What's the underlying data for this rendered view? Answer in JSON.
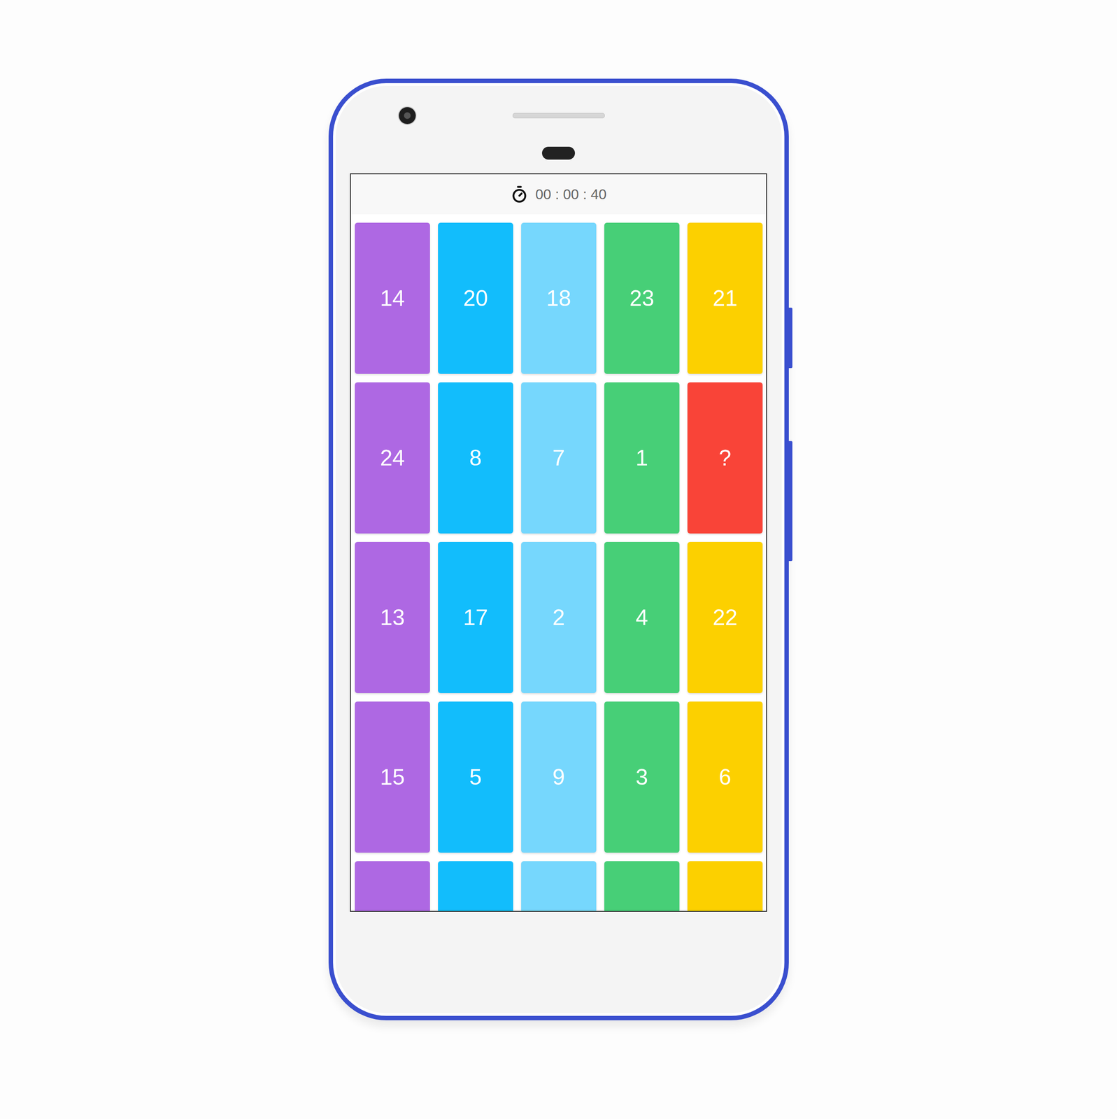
{
  "timer": "00 : 00 : 40",
  "tiles": [
    [
      {
        "label": "14",
        "color": "#ae68e3"
      },
      {
        "label": "20",
        "color": "#12bdfc"
      },
      {
        "label": "18",
        "color": "#76d7fd"
      },
      {
        "label": "23",
        "color": "#47cf77"
      },
      {
        "label": "21",
        "color": "#fcd000"
      }
    ],
    [
      {
        "label": "24",
        "color": "#ae68e3"
      },
      {
        "label": "8",
        "color": "#12bdfc"
      },
      {
        "label": "7",
        "color": "#76d7fd"
      },
      {
        "label": "1",
        "color": "#47cf77"
      },
      {
        "label": "?",
        "color": "#f94438"
      }
    ],
    [
      {
        "label": "13",
        "color": "#ae68e3"
      },
      {
        "label": "17",
        "color": "#12bdfc"
      },
      {
        "label": "2",
        "color": "#76d7fd"
      },
      {
        "label": "4",
        "color": "#47cf77"
      },
      {
        "label": "22",
        "color": "#fcd000"
      }
    ],
    [
      {
        "label": "15",
        "color": "#ae68e3"
      },
      {
        "label": "5",
        "color": "#12bdfc"
      },
      {
        "label": "9",
        "color": "#76d7fd"
      },
      {
        "label": "3",
        "color": "#47cf77"
      },
      {
        "label": "6",
        "color": "#fcd000"
      }
    ]
  ],
  "cut_off_row": [
    {
      "color": "#ae68e3"
    },
    {
      "color": "#12bdfc"
    },
    {
      "color": "#76d7fd"
    },
    {
      "color": "#47cf77"
    },
    {
      "color": "#fcd000"
    }
  ]
}
